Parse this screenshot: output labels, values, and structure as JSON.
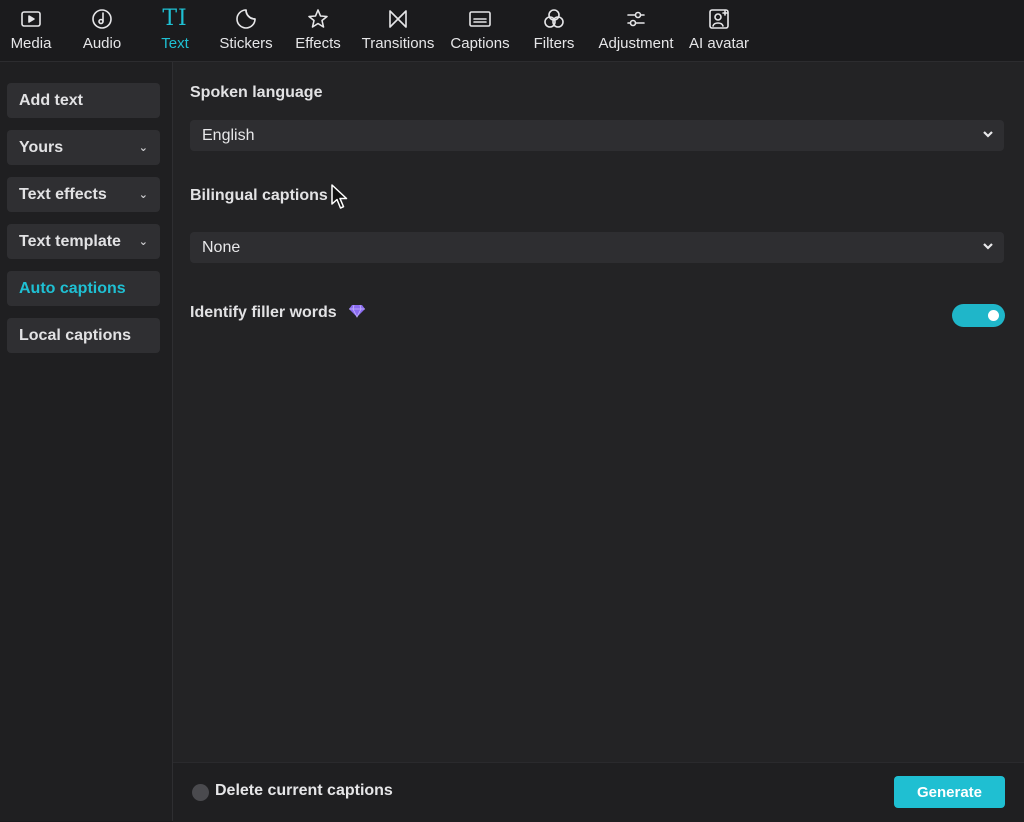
{
  "toolbar": {
    "tabs": [
      {
        "label": "Media",
        "icon": "media-icon"
      },
      {
        "label": "Audio",
        "icon": "audio-icon"
      },
      {
        "label": "Text",
        "icon": "text-icon",
        "glyph": "TI",
        "active": true
      },
      {
        "label": "Stickers",
        "icon": "stickers-icon"
      },
      {
        "label": "Effects",
        "icon": "effects-icon"
      },
      {
        "label": "Transitions",
        "icon": "transitions-icon"
      },
      {
        "label": "Captions",
        "icon": "captions-icon"
      },
      {
        "label": "Filters",
        "icon": "filters-icon"
      },
      {
        "label": "Adjustment",
        "icon": "adjustment-icon"
      },
      {
        "label": "AI avatar",
        "icon": "ai-avatar-icon"
      }
    ]
  },
  "sidebar": {
    "items": [
      {
        "label": "Add text",
        "has_chevron": false
      },
      {
        "label": "Yours",
        "has_chevron": true
      },
      {
        "label": "Text effects",
        "has_chevron": true
      },
      {
        "label": "Text template",
        "has_chevron": true
      },
      {
        "label": "Auto captions",
        "has_chevron": false,
        "active": true
      },
      {
        "label": "Local captions",
        "has_chevron": false
      }
    ]
  },
  "main": {
    "spoken_language": {
      "label": "Spoken language",
      "value": "English"
    },
    "bilingual_captions": {
      "label": "Bilingual captions",
      "value": "None"
    },
    "filler_words": {
      "label": "Identify filler words",
      "badge_icon": "premium-gem-icon",
      "enabled": true
    }
  },
  "footer": {
    "delete_label": "Delete current captions",
    "delete_checked": false,
    "generate_label": "Generate"
  },
  "colors": {
    "accent": "#1fc0d3",
    "background": "#1b1b1d",
    "panel": "#232325",
    "control": "#2e2e31",
    "gem": "#8b6cf0"
  }
}
